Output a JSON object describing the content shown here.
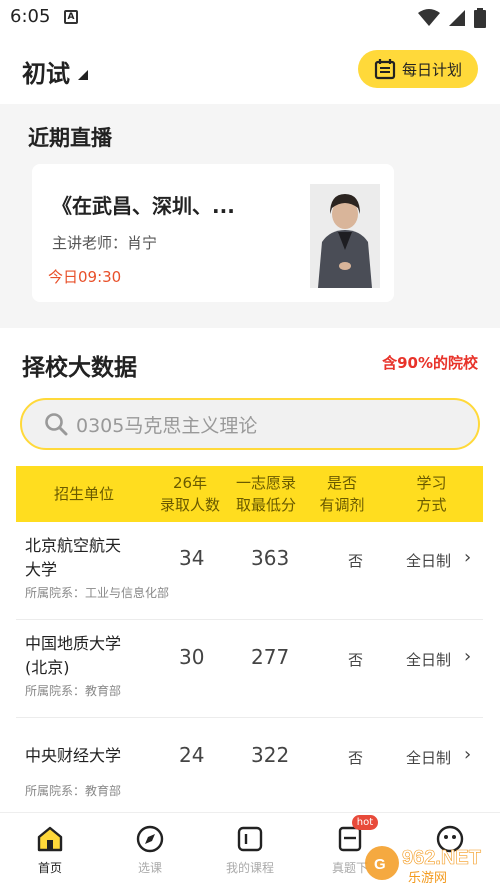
{
  "status_bar": {
    "time": "6:05",
    "notif_letter": "A"
  },
  "header": {
    "title": "初试",
    "plan_button": "每日计划"
  },
  "live": {
    "section_title": "近期直播",
    "card": {
      "title": "《在武昌、深圳、...",
      "teacher": "主讲老师：肖宁",
      "time": "今日09:30"
    }
  },
  "big_data": {
    "title": "择校大数据",
    "badge": "含90%的院校",
    "search_placeholder": "0305马克思主义理论",
    "columns": {
      "unit": "招生单位",
      "enroll_1": "26年",
      "enroll_2": "录取人数",
      "min_1": "一志愿录",
      "min_2": "取最低分",
      "adjust_1": "是否",
      "adjust_2": "有调剂",
      "mode_1": "学习",
      "mode_2": "方式"
    },
    "rows": [
      {
        "school_1": "北京航空航天",
        "school_2": "大学",
        "dept": "所属院系：工业与信息化部",
        "enroll": "34",
        "min_score": "363",
        "adjust": "否",
        "mode": "全日制"
      },
      {
        "school_1": "中国地质大学",
        "school_2": "(北京)",
        "dept": "所属院系：教育部",
        "enroll": "30",
        "min_score": "277",
        "adjust": "否",
        "mode": "全日制"
      },
      {
        "school_1": "中央财经大学",
        "school_2": "",
        "dept": "所属院系：教育部",
        "enroll": "24",
        "min_score": "322",
        "adjust": "否",
        "mode": "全日制"
      }
    ]
  },
  "bottom_nav": {
    "home": "首页",
    "courses": "选课",
    "my_courses": "我的课程",
    "exam": "真题下",
    "hot": "hot"
  },
  "watermark": {
    "text": "962.NET",
    "sub": "乐游网"
  },
  "colors": {
    "accent": "#ffd93a",
    "table_header": "#ffdd1f",
    "red": "#e8332a",
    "orange_time": "#e8502a"
  }
}
